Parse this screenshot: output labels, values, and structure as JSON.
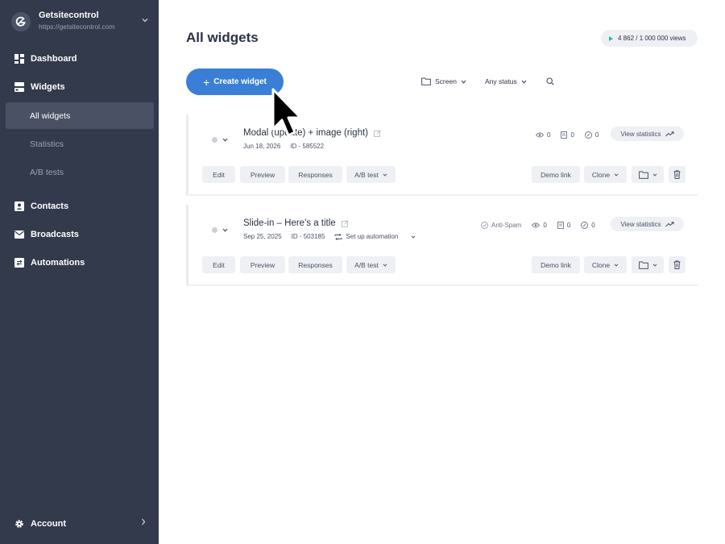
{
  "workspace": {
    "name": "Getsitecontrol",
    "url": "https://getsitecontrol.com"
  },
  "sidebar": {
    "dashboard": "Dashboard",
    "widgets": "Widgets",
    "widgets_sub": [
      "All widgets",
      "Statistics",
      "A/B tests"
    ],
    "contacts": "Contacts",
    "broadcasts": "Broadcasts",
    "automations": "Automations",
    "account": "Account"
  },
  "main": {
    "title": "All widgets",
    "views": "4 862 / 1 000 000 views",
    "create_label": "Create widget",
    "filter_screen": "Screen",
    "filter_status": "Any status"
  },
  "widgets": [
    {
      "title": "Modal (update) + image (right)",
      "date": "Jun 18, 2026",
      "id": "ID - 585522",
      "views": "0",
      "leads": "0",
      "conversion": "0",
      "view_stats": "View statistics"
    },
    {
      "title": "Slide-in – Here's a title",
      "date": "Sep 25, 2025",
      "id": "ID - 503185",
      "automation": "Set up automation",
      "antispam": "Anti-Spam",
      "views": "0",
      "leads": "0",
      "conversion": "0",
      "view_stats": "View statistics"
    }
  ],
  "actions": {
    "edit": "Edit",
    "preview": "Preview",
    "responses": "Responses",
    "abtest": "A/B test",
    "demo": "Demo link",
    "clone": "Clone"
  },
  "colors": {
    "sidebar": "#333a4b",
    "active": "#4a5164",
    "accent": "#3a7fd5",
    "views_marker": "#26b5a4"
  }
}
